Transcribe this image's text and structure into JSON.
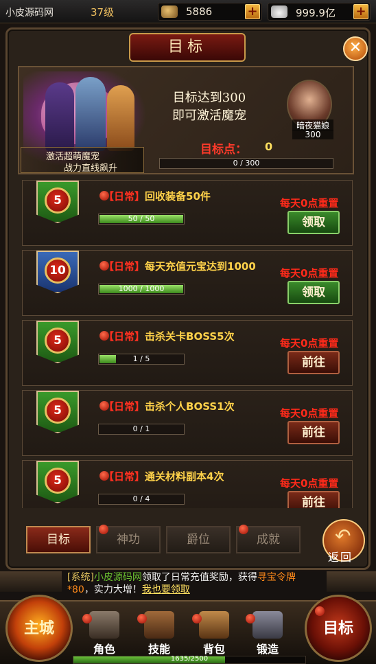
{
  "topbar": {
    "site_name": "小皮源码网",
    "level": "37级",
    "gold": "5886",
    "yuanbao": "999.9亿",
    "plus_label": "+"
  },
  "panel": {
    "title": "目标",
    "close_label": "✕"
  },
  "banner": {
    "promo_line1": "激活超萌魔宠",
    "promo_line2": "战力直线飙升",
    "goal_line1": "目标达到300",
    "goal_line2": "即可激活魔宠",
    "pet_name": "暗夜猫娘",
    "pet_score": "300",
    "points_label": "目标点：",
    "points_value": "0",
    "progress_text": "0 / 300",
    "progress_fraction": 0
  },
  "tasks": [
    {
      "medal": "5",
      "medal_color": "green",
      "tag": "【日常】",
      "name": "回收装备50件",
      "progress_text": "50 / 50",
      "progress_fraction": 1.0,
      "reset": "每天0点重置",
      "button": "领取",
      "button_type": "claim"
    },
    {
      "medal": "10",
      "medal_color": "blue",
      "tag": "【日常】",
      "name": "每天充值元宝达到1000",
      "progress_text": "1000 / 1000",
      "progress_fraction": 1.0,
      "reset": "每天0点重置",
      "button": "领取",
      "button_type": "claim"
    },
    {
      "medal": "5",
      "medal_color": "green",
      "tag": "【日常】",
      "name": "击杀关卡BOSS5次",
      "progress_text": "1 / 5",
      "progress_fraction": 0.2,
      "reset": "每天0点重置",
      "button": "前往",
      "button_type": "go"
    },
    {
      "medal": "5",
      "medal_color": "green",
      "tag": "【日常】",
      "name": "击杀个人BOSS1次",
      "progress_text": "0 / 1",
      "progress_fraction": 0,
      "reset": "每天0点重置",
      "button": "前往",
      "button_type": "go"
    },
    {
      "medal": "5",
      "medal_color": "green",
      "tag": "【日常】",
      "name": "通关材料副本4次",
      "progress_text": "0 / 4",
      "progress_fraction": 0,
      "reset": "每天0点重置",
      "button": "前往",
      "button_type": "go"
    }
  ],
  "tabs": [
    {
      "label": "目标",
      "active": true
    },
    {
      "label": "神功",
      "active": false
    },
    {
      "label": "爵位",
      "active": false
    },
    {
      "label": "成就",
      "active": false
    }
  ],
  "back_label": "返回",
  "system_message": {
    "prefix": "[系统]",
    "site": "小皮源码网",
    "text1": "领取了日常充值奖励，获得",
    "item": "寻宝令牌*80",
    "text2": "，实力大增！",
    "link": "我也要领取"
  },
  "nav": {
    "main_city": "主城",
    "role": "角色",
    "skill": "技能",
    "bag": "背包",
    "forge": "锻造",
    "goal": "目标"
  },
  "exp": {
    "text": "1635/2500",
    "fraction": 0.654
  }
}
